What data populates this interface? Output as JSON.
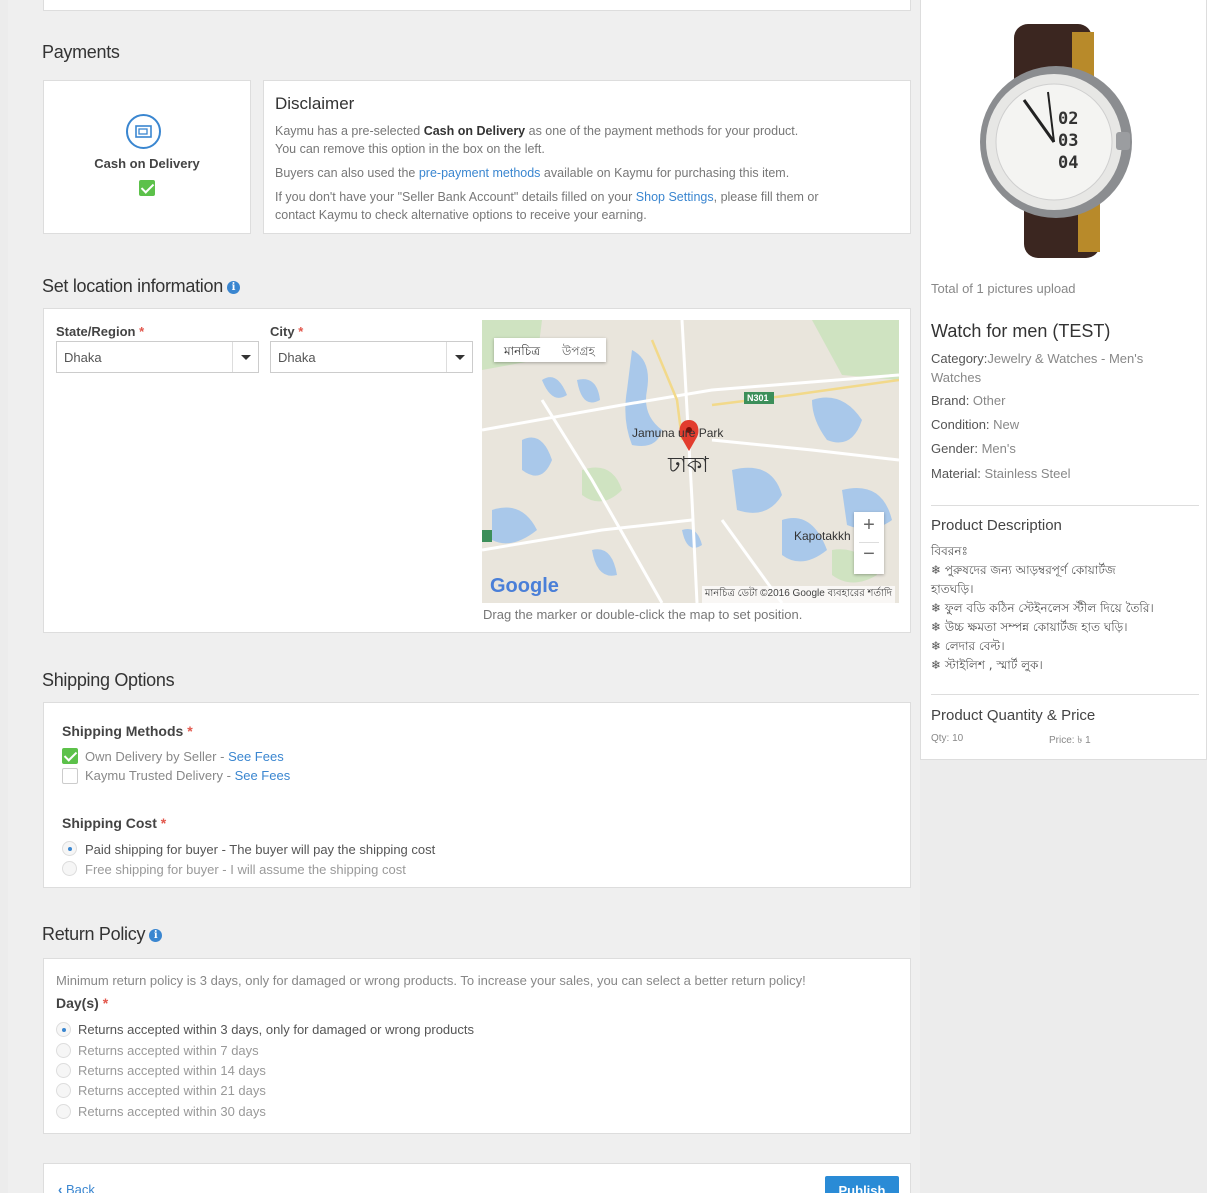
{
  "payments": {
    "heading": "Payments",
    "method_label": "Cash on Delivery",
    "disclaimer_title": "Disclaimer",
    "disclaimer_p1_a": "Kaymu has a pre-selected ",
    "disclaimer_p1_b": "Cash on Delivery",
    "disclaimer_p1_c": " as one of the payment methods for your product.",
    "disclaimer_p1_d": "You can remove this option in the box on the left.",
    "disclaimer_p2_a": "Buyers can also used the ",
    "disclaimer_p2_link": "pre-payment methods",
    "disclaimer_p2_c": " available on Kaymu for purchasing this item.",
    "disclaimer_p3_a": "If you don't have your \"Seller Bank Account\" details filled on your ",
    "disclaimer_p3_link": "Shop Settings",
    "disclaimer_p3_c": ", please fill them or",
    "disclaimer_p3_d": "contact Kaymu to check alternative options to receive your earning."
  },
  "location": {
    "heading": "Set location information",
    "state_label": "State/Region",
    "state_value": "Dhaka",
    "city_label": "City",
    "city_value": "Dhaka",
    "map_tab_map": "মানচিত্র",
    "map_tab_sat": "উপগ্রহ",
    "map_place_main": "ঢাকা",
    "map_place_park": "Jamuna   ure Park",
    "map_place_kapotakkh": "Kapotakkh",
    "map_road": "N301",
    "map_zoom_in": "+",
    "map_zoom_out": "−",
    "map_logo": "Google",
    "map_attrib": "মানচিত্র ডেটা ©2016 Google   ব্যবহারের শর্তাদি",
    "map_hint": "Drag the marker or double-click the map to set position."
  },
  "shipping": {
    "heading": "Shipping Options",
    "methods_label": "Shipping Methods",
    "method1": "Own Delivery by Seller",
    "method1_link": "See Fees",
    "method2": "Kaymu Trusted Delivery",
    "method2_link": "See Fees",
    "cost_label": "Shipping Cost",
    "cost1": "Paid shipping for buyer - The buyer will pay the shipping cost",
    "cost2": "Free shipping for buyer - I will assume the shipping cost"
  },
  "returns": {
    "heading": "Return Policy",
    "note": "Minimum return policy is 3 days, only for damaged or wrong products. To increase your sales, you can select a better return policy!",
    "days_label": "Day(s)",
    "options": [
      "Returns accepted within 3 days, only for damaged or wrong products",
      "Returns accepted within 7 days",
      "Returns accepted within 14 days",
      "Returns accepted within 21 days",
      "Returns accepted within 30 days"
    ]
  },
  "footer": {
    "back": "Back",
    "publish": "Publish"
  },
  "sidebar": {
    "pictures": "Total of 1 pictures upload",
    "title": "Watch for men (TEST)",
    "category_label": "Category:",
    "category_value": "Jewelry & Watches - Men's",
    "category_value2": "Watches",
    "brand_label": "Brand:",
    "brand_value": " Other",
    "condition_label": "Condition:",
    "condition_value": " New",
    "gender_label": "Gender:",
    "gender_value": " Men's",
    "material_label": "Material:",
    "material_value": " Stainless Steel",
    "desc_heading": "Product Description",
    "desc_lines": [
      "বিবরনঃ",
      "❄ পুরুষদের জন্য আড়ম্বরপূর্ণ কোয়ার্টজ",
      "হাতঘড়ি।",
      "❄ ফুল বডি কঠিন স্টেইনলেস স্টীল দিয়ে তৈরি।",
      "❄ উচ্চ ক্ষমতা সম্পন্ন কোয়ার্টজ হাত ঘড়ি।",
      "❄ লেদার বেল্ট।",
      "❄ স্টাইলিশ , স্মার্ট লুক।"
    ],
    "qty_heading": "Product Quantity & Price",
    "qty": "Qty: 10",
    "price": "Price: ৳ 1",
    "watch_numbers": [
      "02",
      "03",
      "04"
    ]
  }
}
